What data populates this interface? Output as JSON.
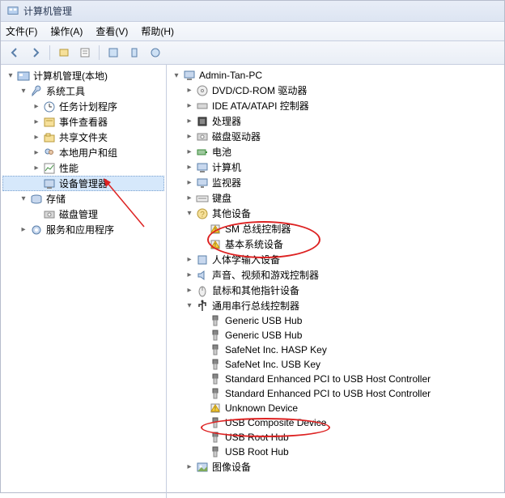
{
  "window": {
    "title": "计算机管理"
  },
  "menu": {
    "file": "文件(F)",
    "action": "操作(A)",
    "view": "查看(V)",
    "help": "帮助(H)"
  },
  "toolbar": {
    "icons": [
      "back-icon",
      "forward-icon",
      "up-icon",
      "props-icon",
      "refresh-icon",
      "export-icon",
      "help-icon"
    ]
  },
  "left_tree": {
    "root": {
      "label": "计算机管理(本地)",
      "icon": "mmc-icon",
      "expanded": true,
      "selected": false,
      "children": [
        {
          "label": "系统工具",
          "icon": "wrench-icon",
          "expanded": true,
          "children": [
            {
              "label": "任务计划程序",
              "icon": "clock-icon",
              "has_children": true,
              "expanded": false
            },
            {
              "label": "事件查看器",
              "icon": "event-icon",
              "has_children": true,
              "expanded": false
            },
            {
              "label": "共享文件夹",
              "icon": "share-icon",
              "has_children": true,
              "expanded": false
            },
            {
              "label": "本地用户和组",
              "icon": "users-icon",
              "has_children": true,
              "expanded": false
            },
            {
              "label": "性能",
              "icon": "perf-icon",
              "has_children": true,
              "expanded": false
            },
            {
              "label": "设备管理器",
              "icon": "device-mgr-icon",
              "has_children": false,
              "expanded": false,
              "selected": true
            }
          ]
        },
        {
          "label": "存储",
          "icon": "storage-icon",
          "expanded": true,
          "children": [
            {
              "label": "磁盘管理",
              "icon": "disk-icon",
              "has_children": false
            }
          ]
        },
        {
          "label": "服务和应用程序",
          "icon": "services-icon",
          "expanded": false,
          "has_children": true
        }
      ]
    }
  },
  "right_tree": {
    "root": {
      "label": "Admin-Tan-PC",
      "icon": "computer-icon",
      "expanded": true,
      "children": [
        {
          "label": "DVD/CD-ROM 驱动器",
          "icon": "dvd-icon",
          "has_children": true,
          "expanded": false
        },
        {
          "label": "IDE ATA/ATAPI 控制器",
          "icon": "ide-icon",
          "has_children": true,
          "expanded": false
        },
        {
          "label": "处理器",
          "icon": "cpu-icon",
          "has_children": true,
          "expanded": false
        },
        {
          "label": "磁盘驱动器",
          "icon": "disk-icon",
          "has_children": true,
          "expanded": false
        },
        {
          "label": "电池",
          "icon": "battery-icon",
          "has_children": true,
          "expanded": false
        },
        {
          "label": "计算机",
          "icon": "computer-icon",
          "has_children": true,
          "expanded": false
        },
        {
          "label": "监视器",
          "icon": "monitor-icon",
          "has_children": true,
          "expanded": false
        },
        {
          "label": "键盘",
          "icon": "keyboard-icon",
          "has_children": true,
          "expanded": false
        },
        {
          "label": "其他设备",
          "icon": "other-icon",
          "expanded": true,
          "children": [
            {
              "label": "SM 总线控制器",
              "icon": "warn-icon",
              "has_children": false
            },
            {
              "label": "基本系统设备",
              "icon": "warn-icon",
              "has_children": false
            }
          ]
        },
        {
          "label": "人体学输入设备",
          "icon": "hid-icon",
          "has_children": true,
          "expanded": false
        },
        {
          "label": "声音、视频和游戏控制器",
          "icon": "sound-icon",
          "has_children": true,
          "expanded": false
        },
        {
          "label": "鼠标和其他指针设备",
          "icon": "mouse-icon",
          "has_children": true,
          "expanded": false
        },
        {
          "label": "通用串行总线控制器",
          "icon": "usb-icon",
          "expanded": true,
          "children": [
            {
              "label": "Generic USB Hub",
              "icon": "usb-plug-icon",
              "has_children": false
            },
            {
              "label": "Generic USB Hub",
              "icon": "usb-plug-icon",
              "has_children": false
            },
            {
              "label": "SafeNet Inc. HASP Key",
              "icon": "usb-plug-icon",
              "has_children": false
            },
            {
              "label": "SafeNet Inc. USB Key",
              "icon": "usb-plug-icon",
              "has_children": false
            },
            {
              "label": "Standard Enhanced PCI to USB Host Controller",
              "icon": "usb-plug-icon",
              "has_children": false
            },
            {
              "label": "Standard Enhanced PCI to USB Host Controller",
              "icon": "usb-plug-icon",
              "has_children": false
            },
            {
              "label": "Unknown Device",
              "icon": "warn-icon",
              "has_children": false
            },
            {
              "label": "USB Composite Device",
              "icon": "usb-plug-icon",
              "has_children": false
            },
            {
              "label": "USB Root Hub",
              "icon": "usb-plug-icon",
              "has_children": false
            },
            {
              "label": "USB Root Hub",
              "icon": "usb-plug-icon",
              "has_children": false
            }
          ]
        },
        {
          "label": "图像设备",
          "icon": "image-icon",
          "has_children": true,
          "expanded": false
        }
      ]
    }
  }
}
